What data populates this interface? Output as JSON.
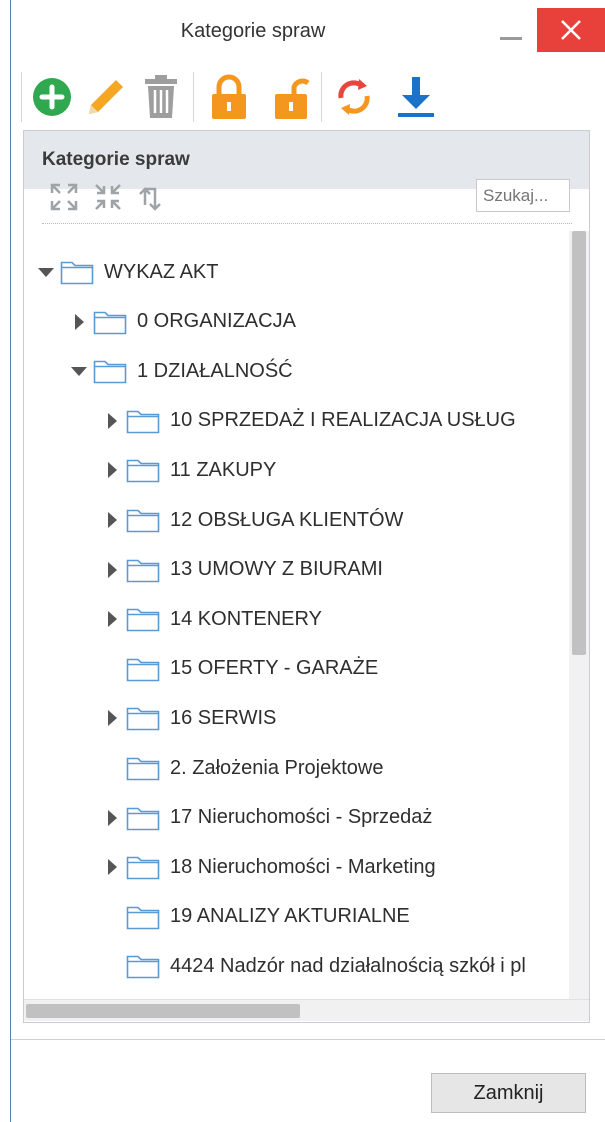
{
  "window": {
    "title": "Kategorie spraw",
    "close_button_label": "Zamknij"
  },
  "toolbar": {
    "buttons": [
      {
        "name": "add",
        "icon": "plus-circle-icon",
        "color": "#2fa84f"
      },
      {
        "name": "edit",
        "icon": "pencil-icon",
        "color": "#f5a623"
      },
      {
        "name": "delete",
        "icon": "trash-icon",
        "color": "#9e9e9e"
      },
      {
        "name": "lock",
        "icon": "lock-closed-icon",
        "color": "#f5961e"
      },
      {
        "name": "unlock",
        "icon": "lock-open-icon",
        "color": "#f5961e"
      },
      {
        "name": "sync",
        "icon": "sync-icon",
        "color": "#e8453c"
      },
      {
        "name": "download",
        "icon": "download-icon",
        "color": "#1a73c8"
      }
    ]
  },
  "panel": {
    "title": "Kategorie spraw",
    "search_placeholder": "Szukaj...",
    "tools": [
      "expand-all-icon",
      "collapse-all-icon",
      "refresh-icon"
    ]
  },
  "tree": {
    "nodes": [
      {
        "label": "WYKAZ AKT",
        "depth": 0,
        "toggle": "expanded"
      },
      {
        "label": "0 ORGANIZACJA",
        "depth": 1,
        "toggle": "collapsed"
      },
      {
        "label": "1 DZIAŁALNOŚĆ",
        "depth": 1,
        "toggle": "expanded"
      },
      {
        "label": "10 SPRZEDAŻ I REALIZACJA USŁUG",
        "depth": 2,
        "toggle": "collapsed"
      },
      {
        "label": "11 ZAKUPY",
        "depth": 2,
        "toggle": "collapsed"
      },
      {
        "label": "12 OBSŁUGA KLIENTÓW",
        "depth": 2,
        "toggle": "collapsed"
      },
      {
        "label": "13 UMOWY Z BIURAMI",
        "depth": 2,
        "toggle": "collapsed"
      },
      {
        "label": "14 KONTENERY",
        "depth": 2,
        "toggle": "collapsed"
      },
      {
        "label": "15 OFERTY - GARAŻE",
        "depth": 2,
        "toggle": "none"
      },
      {
        "label": "16 SERWIS",
        "depth": 2,
        "toggle": "collapsed"
      },
      {
        "label": "2. Założenia Projektowe",
        "depth": 2,
        "toggle": "none"
      },
      {
        "label": "17 Nieruchomości - Sprzedaż",
        "depth": 2,
        "toggle": "collapsed"
      },
      {
        "label": "18 Nieruchomości - Marketing",
        "depth": 2,
        "toggle": "collapsed"
      },
      {
        "label": "19 ANALIZY AKTURIALNE",
        "depth": 2,
        "toggle": "none"
      },
      {
        "label": "4424 Nadzór nad działalnością szkół i pl",
        "depth": 2,
        "toggle": "none"
      },
      {
        "label": "",
        "depth": 2,
        "toggle": "none"
      }
    ]
  },
  "colors": {
    "close_red": "#e8403a",
    "folder_outline": "#5b9bd5",
    "header_bg": "#e4e8ec"
  }
}
